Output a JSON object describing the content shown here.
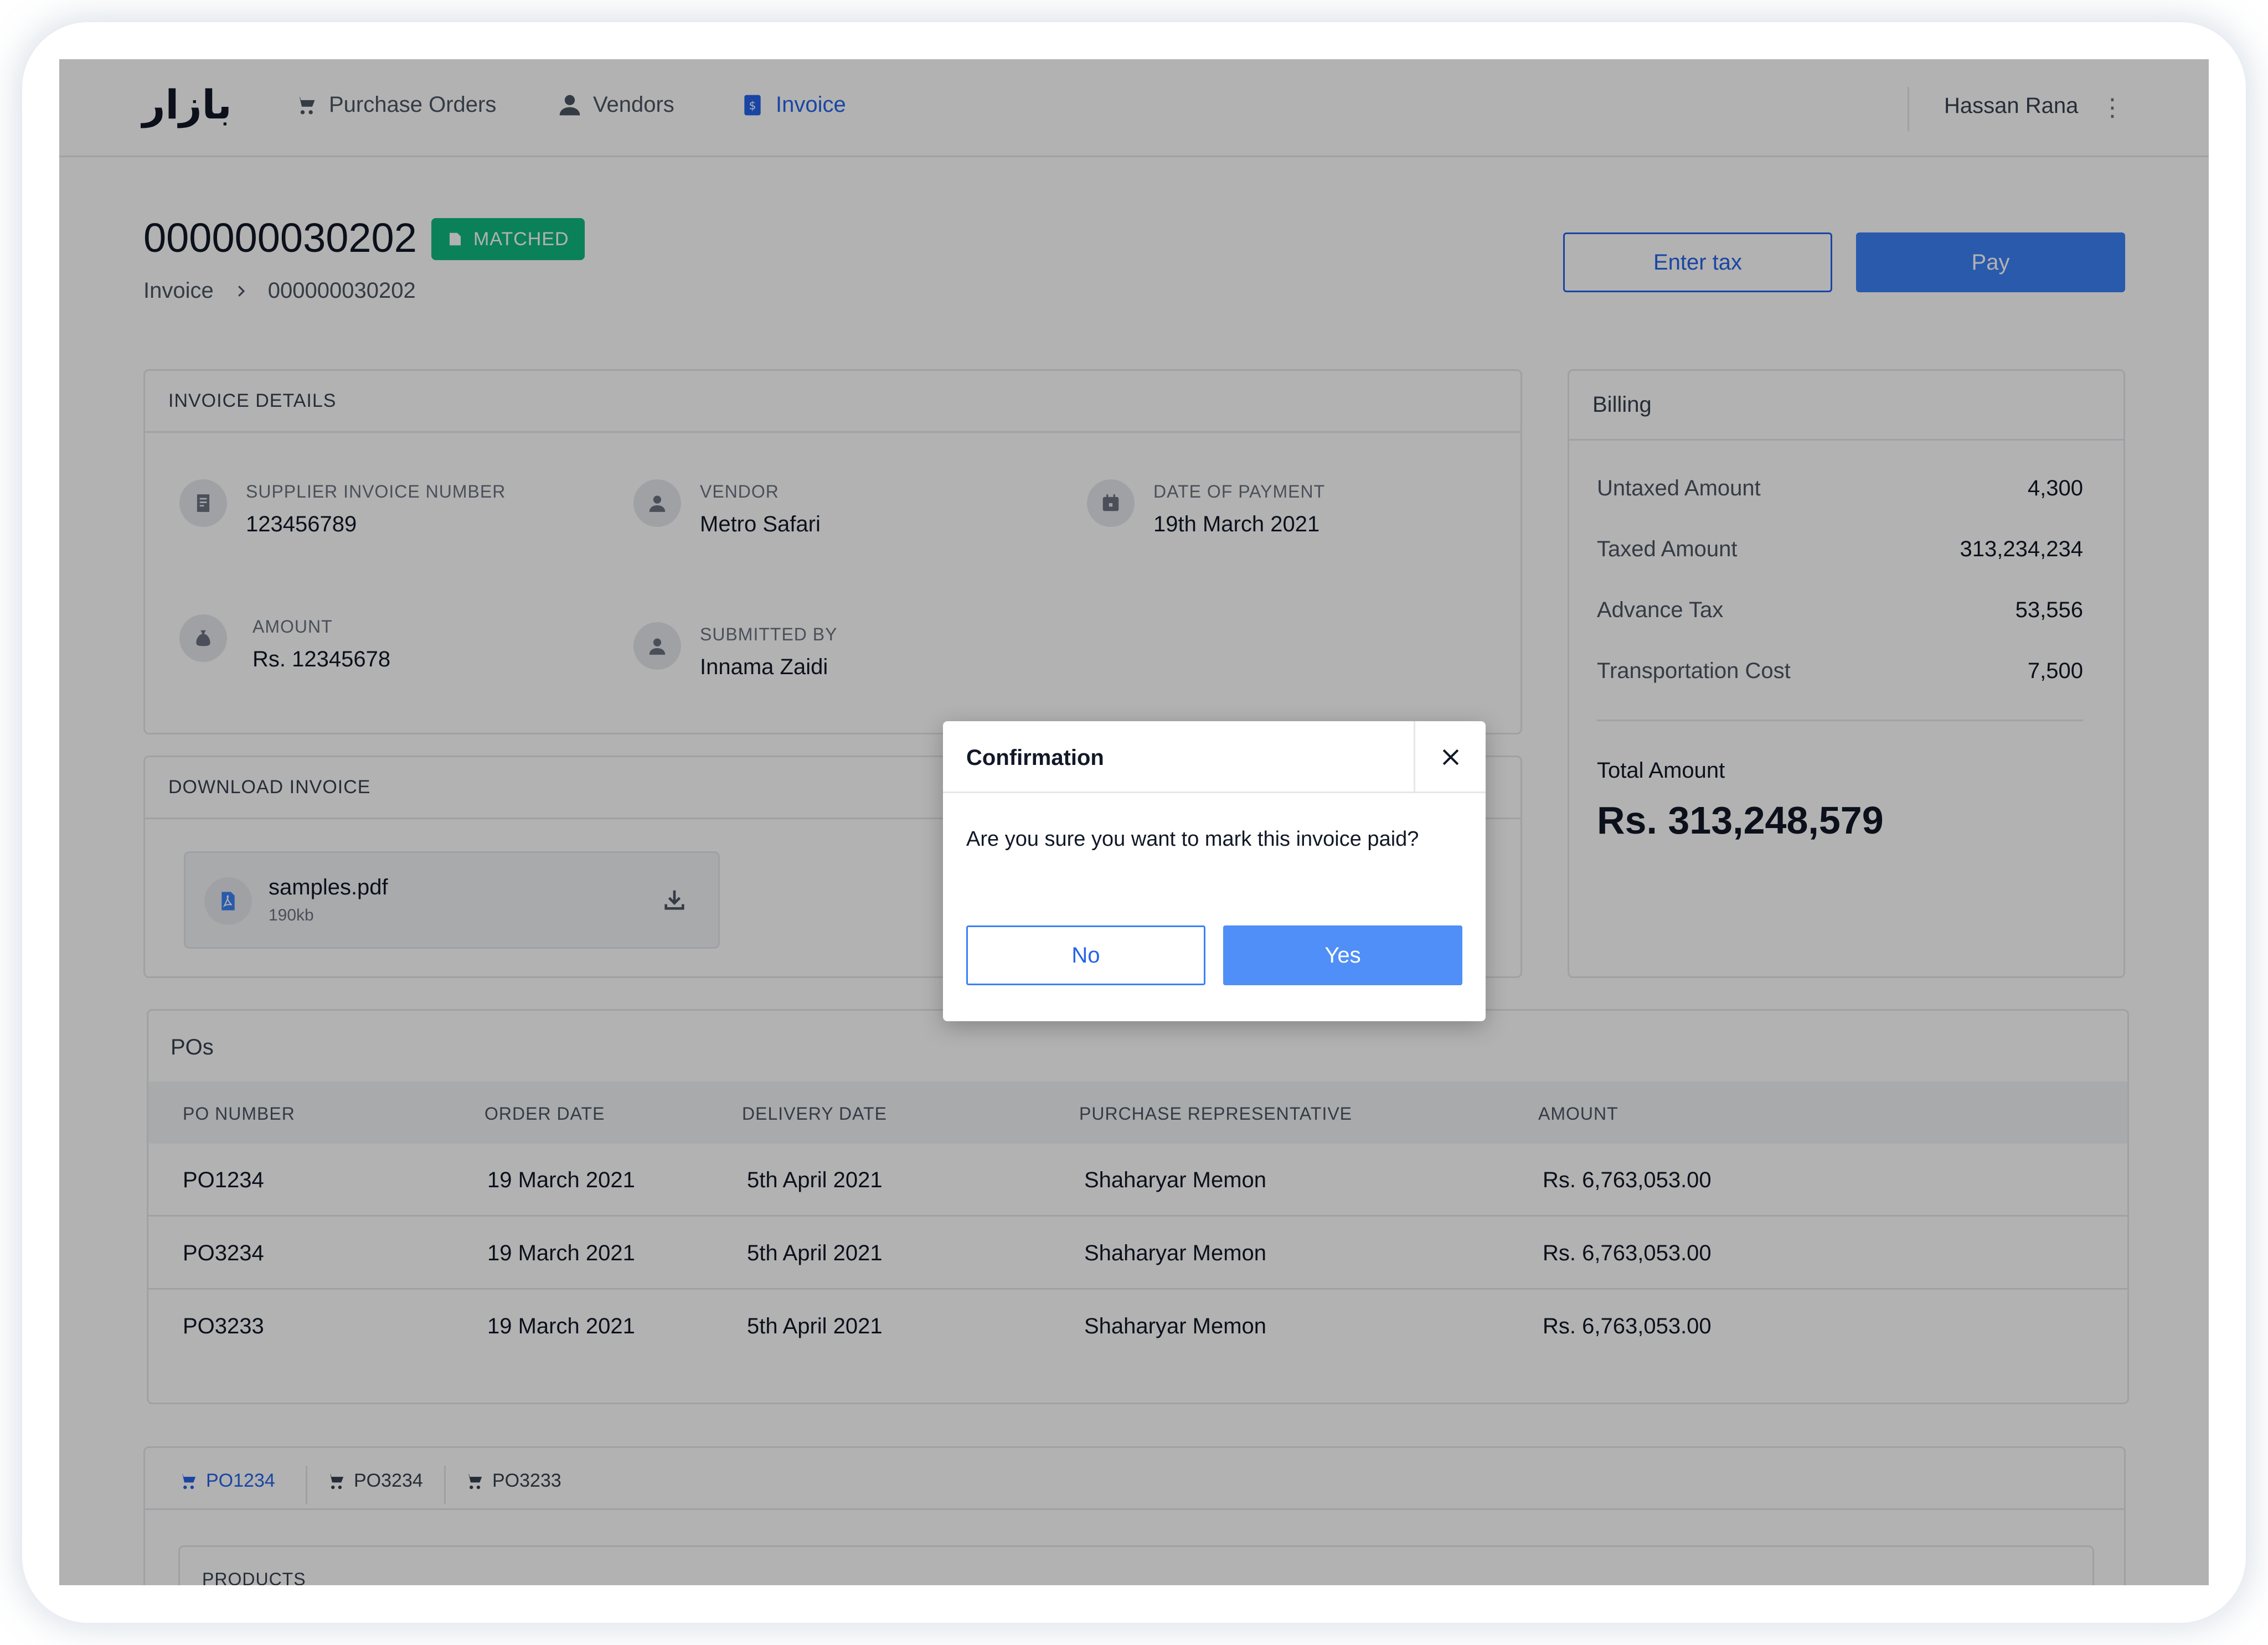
{
  "app": {
    "logo": "بازار"
  },
  "nav": {
    "items": [
      {
        "label": "Purchase Orders",
        "icon": "cart-icon"
      },
      {
        "label": "Vendors",
        "icon": "person-icon"
      },
      {
        "label": "Invoice",
        "icon": "invoice-icon",
        "active": true
      }
    ],
    "user": "Hassan Rana"
  },
  "header": {
    "invoice_number": "000000030202",
    "status": "MATCHED",
    "breadcrumb": [
      "Invoice",
      "000000030202"
    ],
    "enter_tax_label": "Enter tax",
    "pay_label": "Pay"
  },
  "invoice_details": {
    "title": "INVOICE DETAILS",
    "supplier_invoice_number": {
      "label": "SUPPLIER INVOICE NUMBER",
      "value": "123456789"
    },
    "vendor": {
      "label": "VENDOR",
      "value": "Metro Safari"
    },
    "date_of_payment": {
      "label": "DATE OF PAYMENT",
      "value": "19th March 2021"
    },
    "amount": {
      "label": "AMOUNT",
      "value": "Rs. 12345678"
    },
    "submitted_by": {
      "label": "SUBMITTED BY",
      "value": "Innama Zaidi"
    }
  },
  "download": {
    "title": "DOWNLOAD INVOICE",
    "file_name": "samples.pdf",
    "file_size": "190kb"
  },
  "billing": {
    "title": "Billing",
    "rows": [
      {
        "label": "Untaxed Amount",
        "value": "4,300"
      },
      {
        "label": "Taxed Amount",
        "value": "313,234,234"
      },
      {
        "label": "Advance Tax",
        "value": "53,556"
      },
      {
        "label": "Transportation Cost",
        "value": "7,500"
      }
    ],
    "total_label": "Total Amount",
    "total_value": "Rs. 313,248,579"
  },
  "pos": {
    "title": "POs",
    "columns": [
      "PO NUMBER",
      "ORDER DATE",
      "DELIVERY DATE",
      "PURCHASE REPRESENTATIVE",
      "AMOUNT"
    ],
    "rows": [
      [
        "PO1234",
        "19 March 2021",
        "5th April 2021",
        "Shaharyar Memon",
        "Rs. 6,763,053.00"
      ],
      [
        "PO3234",
        "19 March 2021",
        "5th April 2021",
        "Shaharyar Memon",
        "Rs. 6,763,053.00"
      ],
      [
        "PO3233",
        "19 March 2021",
        "5th April 2021",
        "Shaharyar Memon",
        "Rs. 6,763,053.00"
      ]
    ]
  },
  "po_tabs": {
    "tabs": [
      "PO1234",
      "PO3234",
      "PO3233"
    ],
    "products_title": "PRODUCTS"
  },
  "modal": {
    "title": "Confirmation",
    "message": "Are you sure you want to mark this invoice paid?",
    "no_label": "No",
    "yes_label": "Yes"
  },
  "colors": {
    "accent": "#3b82f6",
    "badge": "#10b981"
  }
}
